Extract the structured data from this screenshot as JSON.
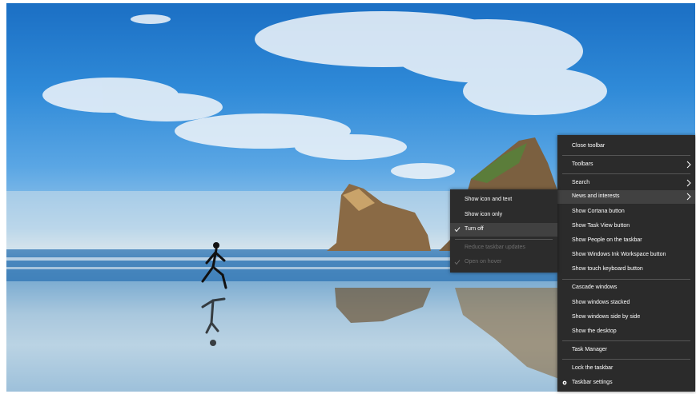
{
  "context_menu": {
    "items": [
      {
        "label": "Close toolbar"
      },
      {
        "label": "Toolbars"
      },
      {
        "label": "Search"
      },
      {
        "label": "News and interests"
      },
      {
        "label": "Show Cortana button"
      },
      {
        "label": "Show Task View button"
      },
      {
        "label": "Show People on the taskbar"
      },
      {
        "label": "Show Windows Ink Workspace button"
      },
      {
        "label": "Show touch keyboard button"
      },
      {
        "label": "Cascade windows"
      },
      {
        "label": "Show windows stacked"
      },
      {
        "label": "Show windows side by side"
      },
      {
        "label": "Show the desktop"
      },
      {
        "label": "Task Manager"
      },
      {
        "label": "Lock the taskbar"
      },
      {
        "label": "Taskbar settings"
      }
    ],
    "highlighted_item": "News and interests"
  },
  "submenu": {
    "items": [
      {
        "label": "Show icon and text",
        "checked": false,
        "enabled": true
      },
      {
        "label": "Show icon only",
        "checked": false,
        "enabled": true
      },
      {
        "label": "Turn off",
        "checked": true,
        "enabled": true
      },
      {
        "label": "Reduce taskbar updates",
        "checked": false,
        "enabled": false
      },
      {
        "label": "Open on hover",
        "checked": true,
        "enabled": false
      }
    ]
  },
  "colors": {
    "menu_background": "#2b2b2b",
    "menu_highlight": "#414141",
    "menu_text": "#ffffff",
    "menu_disabled_text": "#6f6f6f"
  },
  "icons": {
    "submenu_arrow": "chevron-right-icon",
    "checkmark": "checkmark-icon",
    "settings": "gear-icon"
  }
}
